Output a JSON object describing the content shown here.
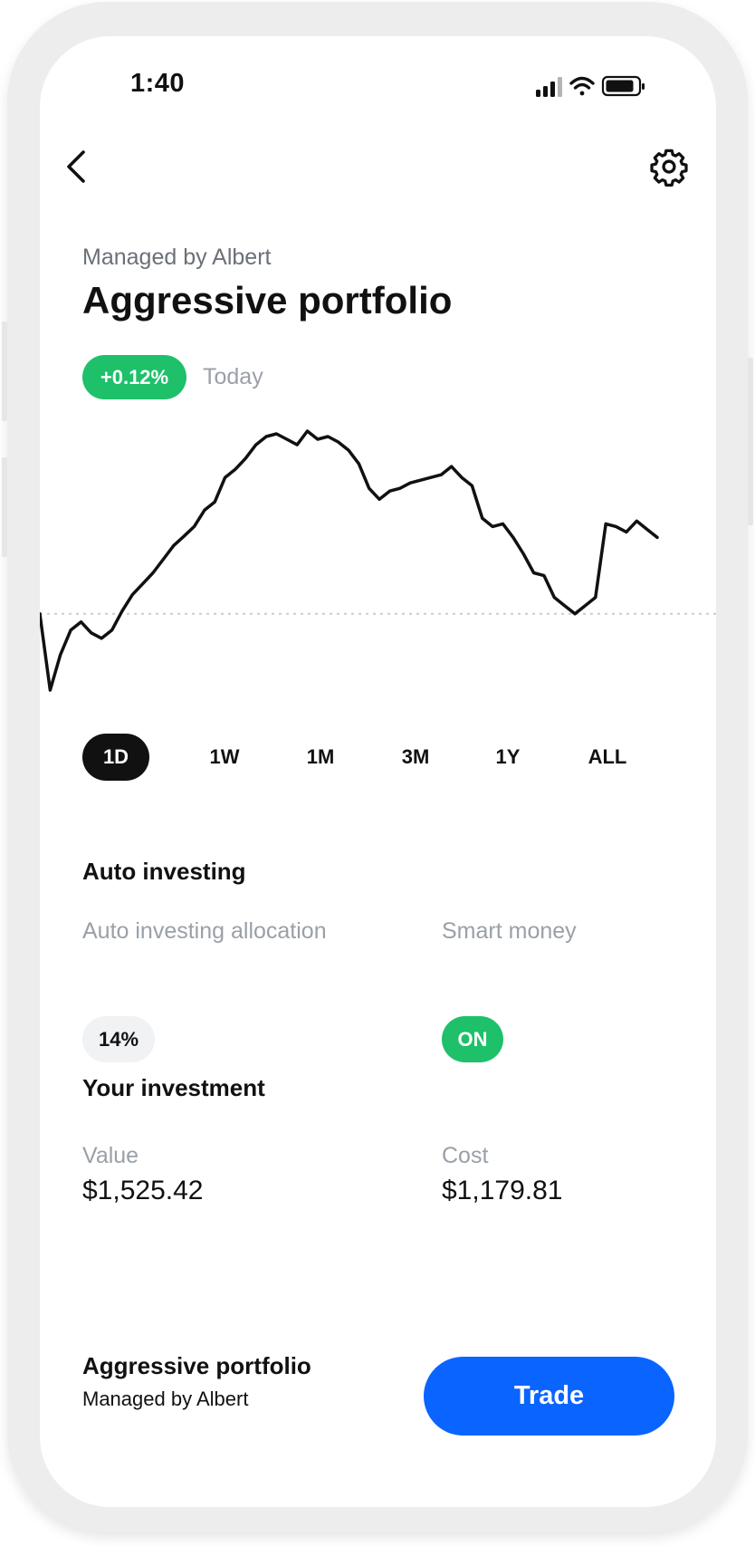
{
  "status_bar": {
    "time": "1:40"
  },
  "header": {
    "back_icon": "chevron-left-icon",
    "settings_icon": "gear-icon",
    "subtitle": "Managed by Albert",
    "title": "Aggressive portfolio"
  },
  "performance": {
    "change": "+0.12%",
    "period": "Today",
    "accent_green": "#1ec06a"
  },
  "chart_data": {
    "type": "line",
    "series": [
      {
        "values": [
          0,
          -140,
          -75,
          -30,
          -15,
          -35,
          -45,
          -30,
          5,
          35,
          55,
          75,
          100,
          125,
          142,
          160,
          190,
          205,
          250,
          265,
          285,
          310,
          325,
          330,
          320,
          310,
          335,
          320,
          325,
          315,
          300,
          275,
          230,
          210,
          225,
          230,
          240,
          245,
          250,
          255,
          270,
          250,
          235,
          175,
          160,
          165,
          140,
          110,
          75,
          70,
          30,
          15,
          0,
          15,
          30,
          165,
          160,
          150,
          170,
          155,
          140
        ]
      }
    ],
    "baseline_value": 0,
    "grid": false,
    "axes": "none"
  },
  "range_tabs": {
    "items": [
      "1D",
      "1W",
      "1M",
      "3M",
      "1Y",
      "ALL"
    ],
    "selected": "1D"
  },
  "auto_investing": {
    "heading": "Auto investing",
    "allocation_label": "Auto investing allocation",
    "allocation_value": "14%",
    "smart_money_label": "Smart money",
    "smart_money_value": "ON"
  },
  "investment": {
    "heading": "Your investment",
    "value_label": "Value",
    "value": "$1,525.42",
    "cost_label": "Cost",
    "cost": "$1,179.81"
  },
  "footer": {
    "title": "Aggressive portfolio",
    "subtitle": "Managed by Albert",
    "trade_label": "Trade",
    "accent_blue": "#0a64ff"
  }
}
